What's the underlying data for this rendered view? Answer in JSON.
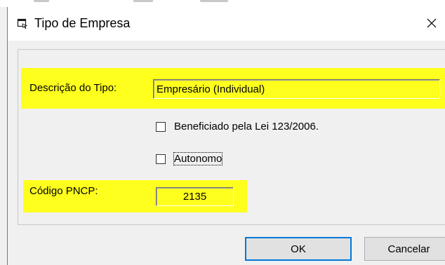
{
  "window": {
    "title": "Tipo de Empresa",
    "icon": "form-window-icon",
    "close_icon": "close-icon"
  },
  "form": {
    "descricao_label": "Descrição do Tipo:",
    "descricao_value": "Empresário (Individual)",
    "checkbox_lei_label": "Beneficiado pela Lei 123/2006.",
    "checkbox_lei_checked": false,
    "checkbox_autonomo_label": "Autonomo",
    "checkbox_autonomo_checked": false,
    "pncp_label": "Código PNCP:",
    "pncp_value": "2135"
  },
  "buttons": {
    "ok_label": "OK",
    "cancel_label": "Cancelar"
  },
  "colors": {
    "highlight": "#ffff1e",
    "focus_border": "#0078d7"
  }
}
